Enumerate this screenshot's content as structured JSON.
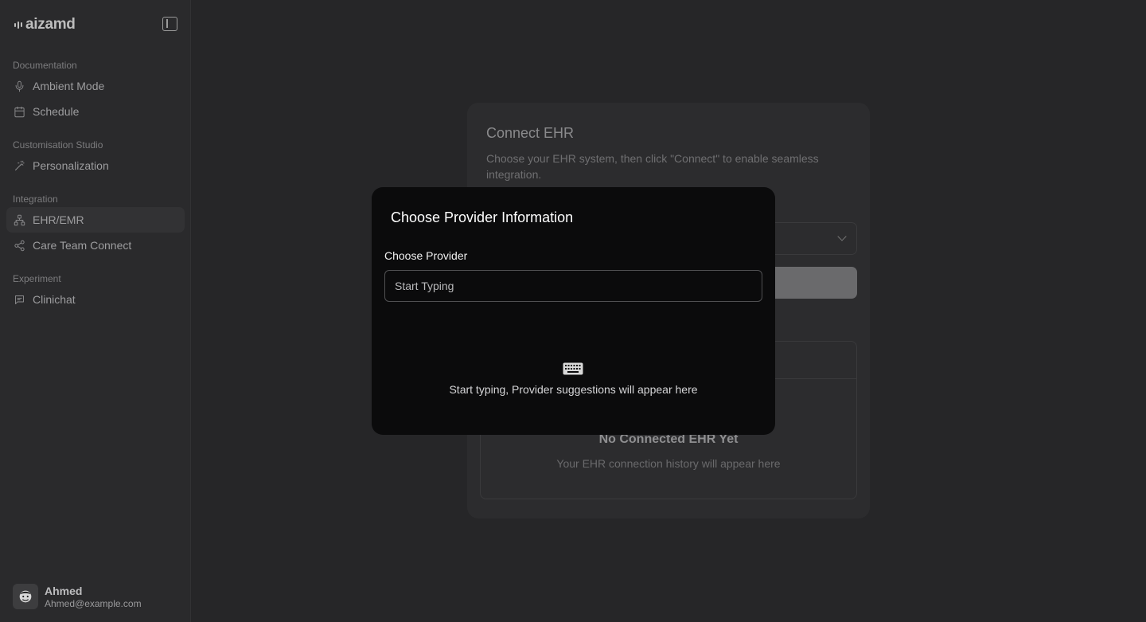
{
  "sidebar": {
    "brand": "aizamd",
    "sections": [
      {
        "label": "Documentation"
      },
      {
        "label": "Customisation Studio"
      },
      {
        "label": "Integration"
      },
      {
        "label": "Experiment"
      }
    ],
    "items": [
      {
        "label": "Ambient Mode",
        "icon": "microphone-icon"
      },
      {
        "label": "Schedule",
        "icon": "calendar-icon"
      },
      {
        "label": "Personalization",
        "icon": "magic-wand-icon"
      },
      {
        "label": "EHR/EMR",
        "icon": "network-icon",
        "active": true
      },
      {
        "label": "Care Team Connect",
        "icon": "share-icon"
      },
      {
        "label": "Clinichat",
        "icon": "chat-icon"
      }
    ],
    "user": {
      "name": "Ahmed",
      "email": "Ahmed@example.com"
    }
  },
  "background_card": {
    "title": "Connect EHR",
    "subtitle": "Choose your EHR system, then click \"Connect\" to enable seamless integration.",
    "empty_title": "No Connected EHR Yet",
    "empty_subtitle": "Your EHR connection history will appear here"
  },
  "modal": {
    "title": "Choose Provider Information",
    "field_label": "Choose Provider",
    "input_placeholder": "Start Typing",
    "input_value": "",
    "hint": "Start typing, Provider suggestions will appear here"
  }
}
